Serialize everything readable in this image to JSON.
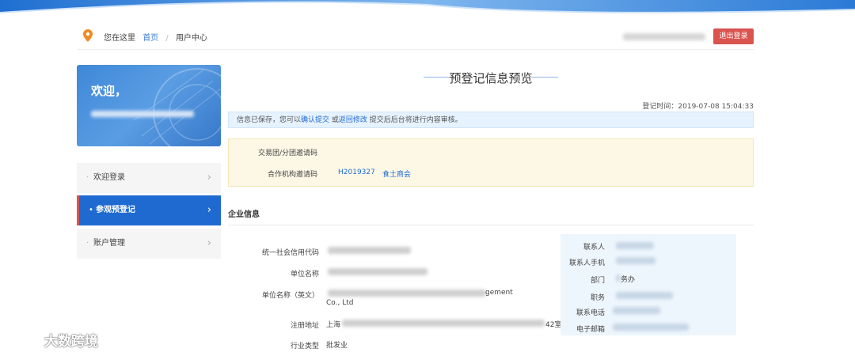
{
  "header": {
    "you_are_here": "您在这里",
    "home": "首页",
    "separator": "/",
    "current": "用户中心",
    "logout_label": "退出登录"
  },
  "sidebar": {
    "welcome": "欢迎，",
    "items": [
      {
        "label": "欢迎登录",
        "active": false
      },
      {
        "label": "参观预登记",
        "active": true
      },
      {
        "label": "账户管理",
        "active": false
      }
    ]
  },
  "main": {
    "title": "预登记信息预览",
    "reg_time_label": "登记时间：",
    "reg_time": "2019-07-08 15:04:33",
    "notice": {
      "prefix": "信息已保存，您可以",
      "confirm": "确认提交",
      "or": " 或",
      "back": "返回修改",
      "suffix": " 提交后后台将进行内容审核。"
    },
    "codes": {
      "group_label": "交易团/分团邀请码",
      "partner_label": "合作机构邀请码",
      "partner_code": "H2019327",
      "partner_name": "食土商会"
    },
    "section_title": "企业信息",
    "company": {
      "credit_code_label": "统一社会信用代码",
      "name_label": "单位名称",
      "name_en_label": "单位名称（英文）",
      "name_en_tail1": "gement",
      "name_en_line2": "Co., Ltd",
      "address_label": "注册地址",
      "address_start": "上海",
      "address_tail": "42室",
      "industry_label": "行业类型",
      "industry_value": "批发业"
    },
    "contact": {
      "person_label": "联系人",
      "mobile_label": "联系人手机",
      "dept_label": "部门",
      "dept_value_tail": "务办",
      "position_label": "职务",
      "phone_label": "联系电话",
      "email_label": "电子邮箱"
    }
  },
  "watermark": "大数跨境",
  "colors": {
    "primary": "#1f6ad0",
    "danger": "#d9534f",
    "notice_bg": "#e6f2fd",
    "codes_bg": "#fdf8e6"
  }
}
